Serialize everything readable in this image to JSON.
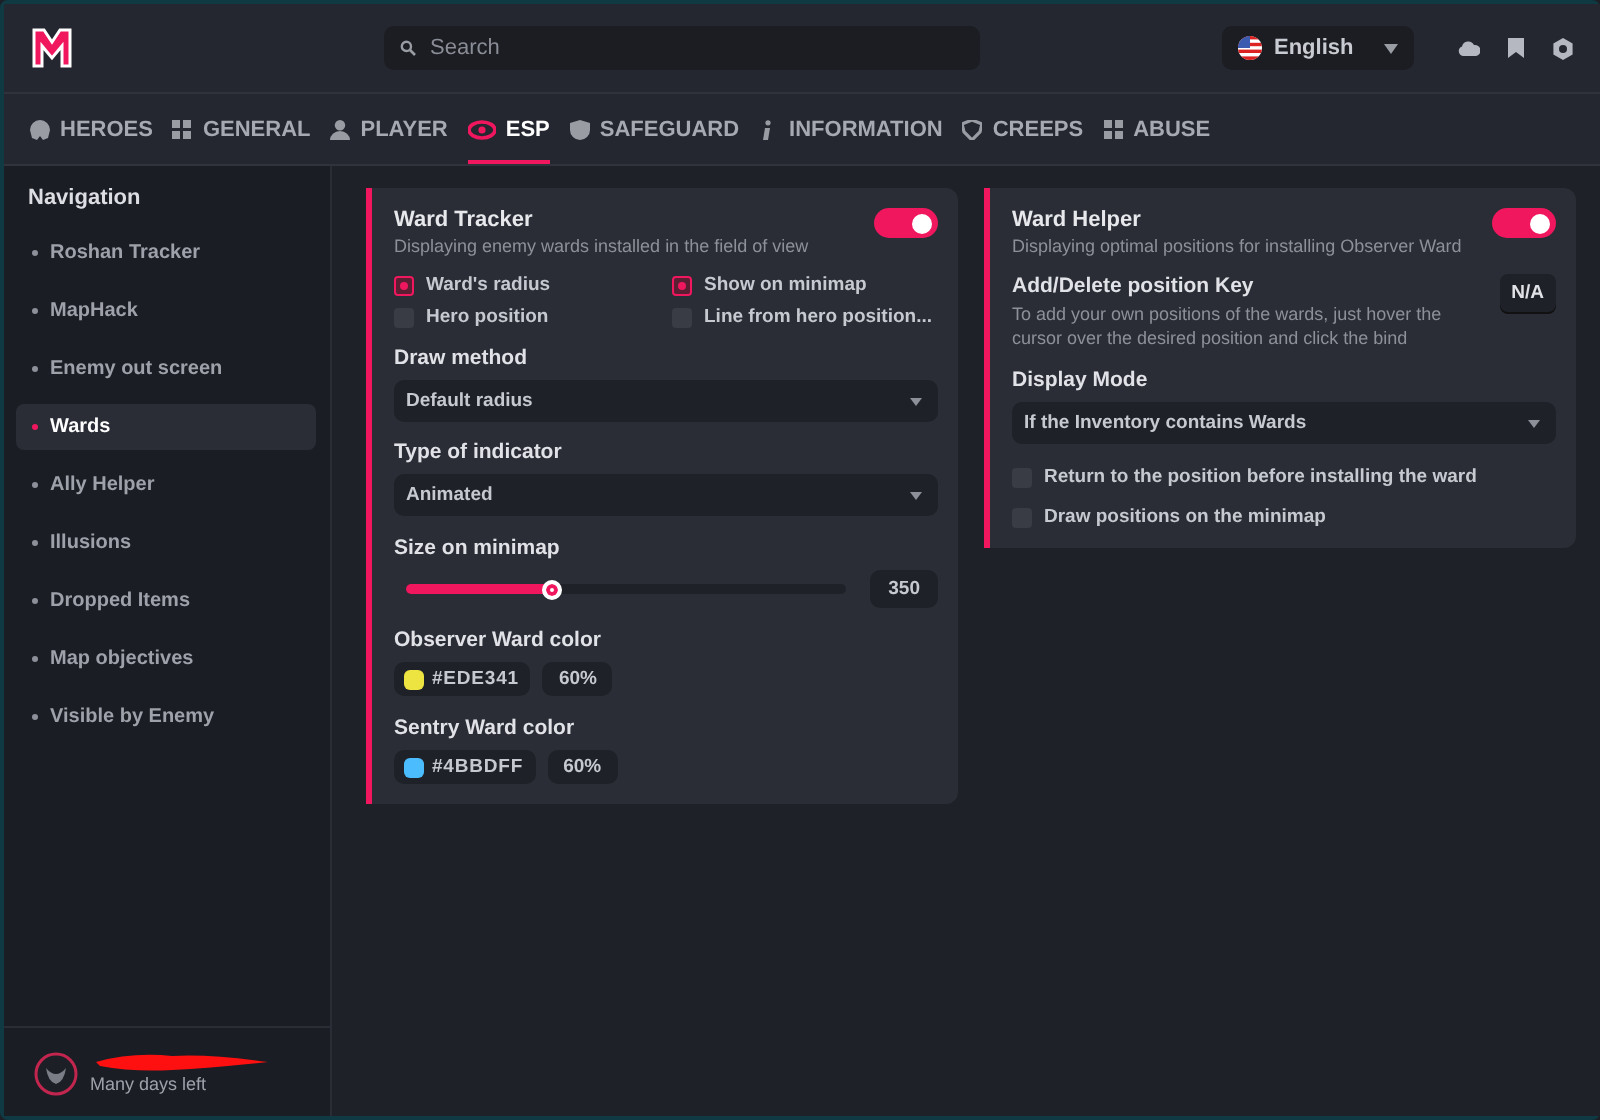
{
  "search": {
    "placeholder": "Search"
  },
  "language": {
    "value": "English"
  },
  "tabs": [
    {
      "label": "HEROES",
      "selected": false
    },
    {
      "label": "GENERAL",
      "selected": false
    },
    {
      "label": "PLAYER",
      "selected": false
    },
    {
      "label": "ESP",
      "selected": true
    },
    {
      "label": "SAFEGUARD",
      "selected": false
    },
    {
      "label": "INFORMATION",
      "selected": false
    },
    {
      "label": "CREEPS",
      "selected": false
    },
    {
      "label": "ABUSE",
      "selected": false
    }
  ],
  "navigation": {
    "title": "Navigation",
    "items": [
      {
        "label": "Roshan Tracker",
        "selected": false
      },
      {
        "label": "MapHack",
        "selected": false
      },
      {
        "label": "Enemy out screen",
        "selected": false
      },
      {
        "label": "Wards",
        "selected": true
      },
      {
        "label": "Ally Helper",
        "selected": false
      },
      {
        "label": "Illusions",
        "selected": false
      },
      {
        "label": "Dropped Items",
        "selected": false
      },
      {
        "label": "Map objectives",
        "selected": false
      },
      {
        "label": "Visible by Enemy",
        "selected": false
      }
    ]
  },
  "cards": [
    {
      "title": "Ward Tracker",
      "description": "Displaying enemy wards installed in the field of view",
      "on": true,
      "rows": [
        {
          "kind": "checkgrid",
          "items": [
            {
              "label": "Ward's radius",
              "checked": true
            },
            {
              "label": "Show on minimap",
              "checked": true
            },
            {
              "label": "Hero position",
              "checked": false
            },
            {
              "label": "Line from hero position...",
              "checked": false
            }
          ]
        },
        {
          "kind": "select",
          "label": "Draw method",
          "value": "Default radius"
        },
        {
          "kind": "select",
          "label": "Type of indicator",
          "value": "Animated"
        },
        {
          "kind": "slider",
          "label": "Size on minimap",
          "level": 0.33,
          "reading": "350"
        },
        {
          "kind": "color",
          "label": "Observer Ward color",
          "color": "#ede341",
          "hex": "#EDE341",
          "opacity": "60%"
        },
        {
          "kind": "color",
          "label": "Sentry Ward color",
          "color": "#4bbdff",
          "hex": "#4BBDFF",
          "opacity": "60%"
        }
      ]
    },
    {
      "title": "Ward Helper",
      "description": "Displaying optimal positions for installing Observer Ward",
      "on": true,
      "rows": [
        {
          "kind": "keybind",
          "label": "Add/Delete position Key",
          "description": "To add your own positions of the wards, just hover the cursor over the desired position and click the bind",
          "key": "N/A"
        },
        {
          "kind": "select",
          "label": "Display Mode",
          "value": "If the Inventory contains Wards"
        },
        {
          "kind": "checkbox",
          "label": "Return to the position before installing the ward",
          "checked": false
        },
        {
          "kind": "checkbox",
          "label": "Draw positions on the minimap",
          "checked": false
        }
      ]
    }
  ],
  "user": {
    "status": "Many days left"
  }
}
